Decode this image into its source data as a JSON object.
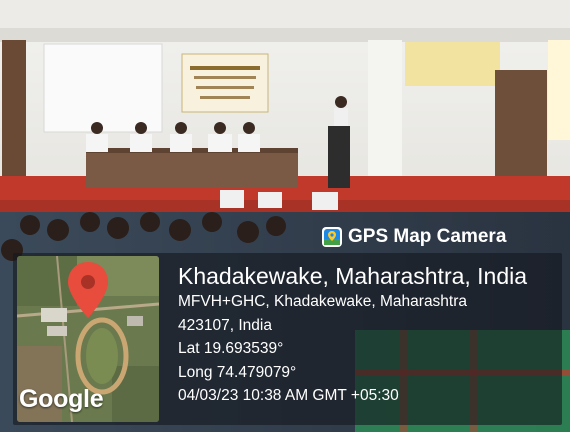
{
  "app": {
    "name": "GPS Map Camera"
  },
  "map": {
    "provider_label": "Google",
    "pin_color": "#e74c3c"
  },
  "location": {
    "title": "Khadakewake, Maharashtra, India",
    "address_line1": "MFVH+GHC, Khadakewake, Maharashtra",
    "address_line2": "423107, India",
    "latitude": "Lat 19.693539°",
    "longitude": "Long 74.479079°",
    "timestamp": "04/03/23 10:38 AM GMT +05:30"
  },
  "colors": {
    "stage_red": "#c0392b",
    "overlay": "#1c2127"
  }
}
